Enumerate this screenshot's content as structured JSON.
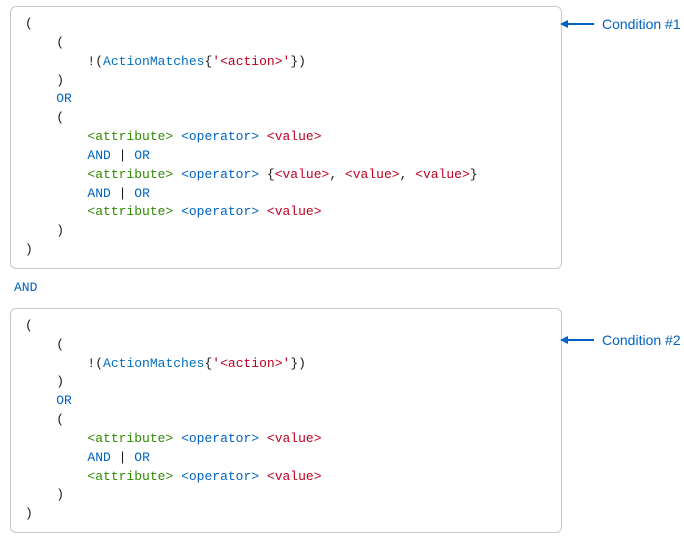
{
  "colors": {
    "accent": "#0062c3",
    "attribute": "#2e8b00",
    "value": "#c00020",
    "border": "#c9c9c9"
  },
  "between": {
    "and_kw": "AND"
  },
  "callouts": {
    "c1": "Condition #1",
    "c2": "Condition #2"
  },
  "sym": {
    "lp": "(",
    "rp": ")",
    "lb": "{",
    "rb": "}",
    "comma": ",",
    "bang": "!",
    "bar": "|",
    "sq": "'"
  },
  "kw": {
    "or": "OR",
    "and": "AND",
    "action_matches": "ActionMatches"
  },
  "ph": {
    "action": "<action>",
    "attribute": "<attribute>",
    "operator": "<operator>",
    "value": "<value>"
  }
}
